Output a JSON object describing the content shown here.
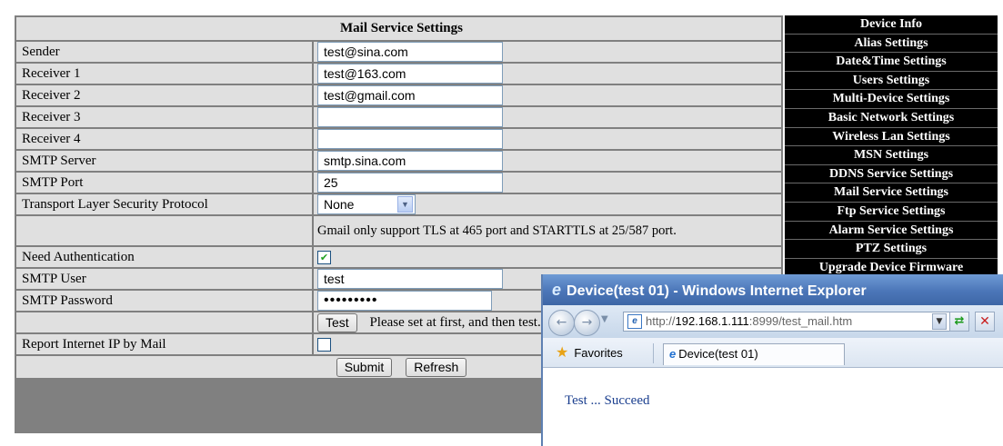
{
  "settings": {
    "title": "Mail Service Settings",
    "sender_label": "Sender",
    "sender_value": "test@sina.com",
    "receiver1_label": "Receiver 1",
    "receiver1_value": "test@163.com",
    "receiver2_label": "Receiver 2",
    "receiver2_value": "test@gmail.com",
    "receiver3_label": "Receiver 3",
    "receiver3_value": "",
    "receiver4_label": "Receiver 4",
    "receiver4_value": "",
    "smtp_server_label": "SMTP Server",
    "smtp_server_value": "smtp.sina.com",
    "smtp_port_label": "SMTP Port",
    "smtp_port_value": "25",
    "tls_label": "Transport Layer Security Protocol",
    "tls_selected": "None",
    "tls_note": "Gmail only support TLS at 465 port and STARTTLS at 25/587 port.",
    "need_auth_label": "Need Authentication",
    "need_auth_checked": true,
    "smtp_user_label": "SMTP User",
    "smtp_user_value": "test",
    "smtp_password_label": "SMTP Password",
    "smtp_password_masked": "•••••••••",
    "test_button": "Test",
    "test_note": "Please set at first, and then test.",
    "report_ip_label": "Report Internet IP by Mail",
    "report_ip_checked": false,
    "submit_button": "Submit",
    "refresh_button": "Refresh"
  },
  "nav": {
    "items": [
      "Device Info",
      "Alias Settings",
      "Date&Time Settings",
      "Users Settings",
      "Multi-Device Settings",
      "Basic Network Settings",
      "Wireless Lan Settings",
      "MSN Settings",
      "DDNS Service Settings",
      "Mail Service Settings",
      "Ftp Service Settings",
      "Alarm Service Settings",
      "PTZ Settings",
      "Upgrade Device Firmware"
    ]
  },
  "popup": {
    "title": "Device(test 01) - Windows Internet Explorer",
    "url_prefix": "http://",
    "url_host": "192.168.1.111",
    "url_rest": ":8999/test_mail.htm",
    "favorites_label": "Favorites",
    "tab_label": "Device(test 01)",
    "result_text": "Test ... Succeed"
  },
  "colors": {
    "panel_border": "#808080",
    "cell_bg": "#e0e0e0",
    "nav_bg": "#000000",
    "ie_title": "#4b76b8",
    "result_text": "#1b3f8f"
  },
  "icons": [
    "ie-logo-icon",
    "back-arrow-icon",
    "forward-arrow-icon",
    "page-icon",
    "refresh-icon",
    "stop-icon",
    "favorites-star-icon",
    "dropdown-arrow-icon",
    "checkmark-icon"
  ]
}
